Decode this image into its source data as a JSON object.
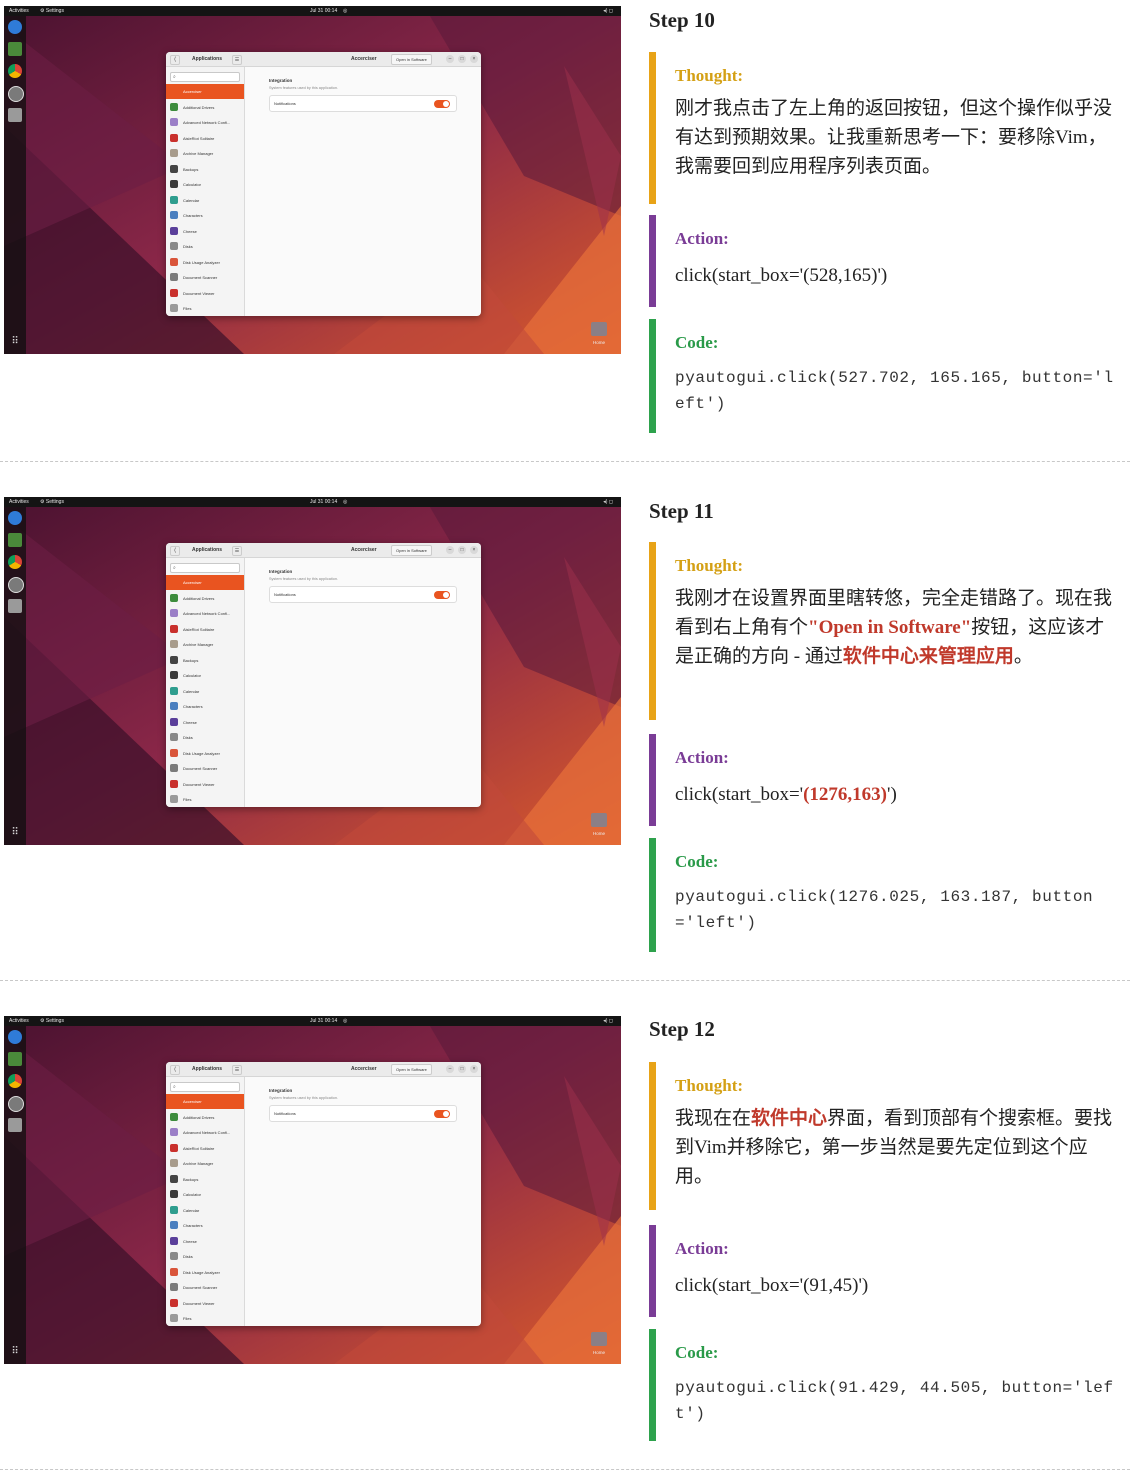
{
  "desktop": {
    "activities": "Activities",
    "settings_app": "Settings",
    "clock": "Jul 31 00:14",
    "bell": "◎",
    "tray": "◂) ◻",
    "home_label": "Home",
    "grid_icon": "⠿"
  },
  "window": {
    "back": "⟨",
    "apps_title": "Applications",
    "menu": "☰",
    "title": "Accerciser",
    "open_in_software": "Open in Software",
    "min": "–",
    "max": "□",
    "close": "×",
    "search_icon": "⌕",
    "integration_heading": "Integration",
    "integration_sub": "System features used by this application.",
    "notifications_label": "Notifications",
    "apps": [
      {
        "label": "Accerciser",
        "color": "#e95420"
      },
      {
        "label": "Additional Drivers",
        "color": "#3d8c3d"
      },
      {
        "label": "Advanced Network Confi...",
        "color": "#9b7fc7"
      },
      {
        "label": "AisleRiot Solitaire",
        "color": "#c9302c"
      },
      {
        "label": "Archive Manager",
        "color": "#a89c8c"
      },
      {
        "label": "Backups",
        "color": "#444444"
      },
      {
        "label": "Calculator",
        "color": "#3a3a3a"
      },
      {
        "label": "Calendar",
        "color": "#2f9e8f"
      },
      {
        "label": "Characters",
        "color": "#4a7fbf"
      },
      {
        "label": "Cheese",
        "color": "#5a3f9a"
      },
      {
        "label": "Disks",
        "color": "#888888"
      },
      {
        "label": "Disk Usage Analyzer",
        "color": "#d9553a"
      },
      {
        "label": "Document Scanner",
        "color": "#7b7b7b"
      },
      {
        "label": "Document Viewer",
        "color": "#c9302c"
      },
      {
        "label": "Files",
        "color": "#9a9a9a"
      }
    ]
  },
  "steps": [
    {
      "title": "Step 10",
      "thought_label": "Thought:",
      "thought": [
        {
          "t": "刚才我点击了左上角的返回按钮，但这个操作似乎没有达到预期效果。让我重新思考一下：要移除Vim，我需要回到应用程序列表页面。",
          "red": false
        }
      ],
      "action_label": "Action:",
      "action": [
        {
          "t": "click(start_box='(528,165)')",
          "red": false
        }
      ],
      "code_label": "Code:",
      "code": "pyautogui.click(527.702, 165.165, button='left')"
    },
    {
      "title": "Step 11",
      "thought_label": "Thought:",
      "thought": [
        {
          "t": "我刚才在设置界面里瞎转悠，完全走错路了。现在我看到右上角有个",
          "red": false
        },
        {
          "t": "\"Open in Software\"",
          "red": true
        },
        {
          "t": "按钮，这应该才是正确的方向 - 通过",
          "red": false
        },
        {
          "t": "软件中心来管理应用",
          "red": true
        },
        {
          "t": "。",
          "red": false
        }
      ],
      "action_label": "Action:",
      "action": [
        {
          "t": "click(start_box='",
          "red": false
        },
        {
          "t": "(1276,163)",
          "red": true
        },
        {
          "t": "')",
          "red": false
        }
      ],
      "code_label": "Code:",
      "code": "pyautogui.click(1276.025, 163.187, button='left')"
    },
    {
      "title": "Step 12",
      "thought_label": "Thought:",
      "thought": [
        {
          "t": "我现在在",
          "red": false
        },
        {
          "t": "软件中心",
          "red": true
        },
        {
          "t": "界面，看到顶部有个搜索框。要找到Vim并移除它，第一步当然是要先定位到这个应用。",
          "red": false
        }
      ],
      "action_label": "Action:",
      "action": [
        {
          "t": "click(start_box='(91,45)')",
          "red": false
        }
      ],
      "code_label": "Code:",
      "code": "pyautogui.click(91.429, 44.505, button='left')"
    }
  ]
}
